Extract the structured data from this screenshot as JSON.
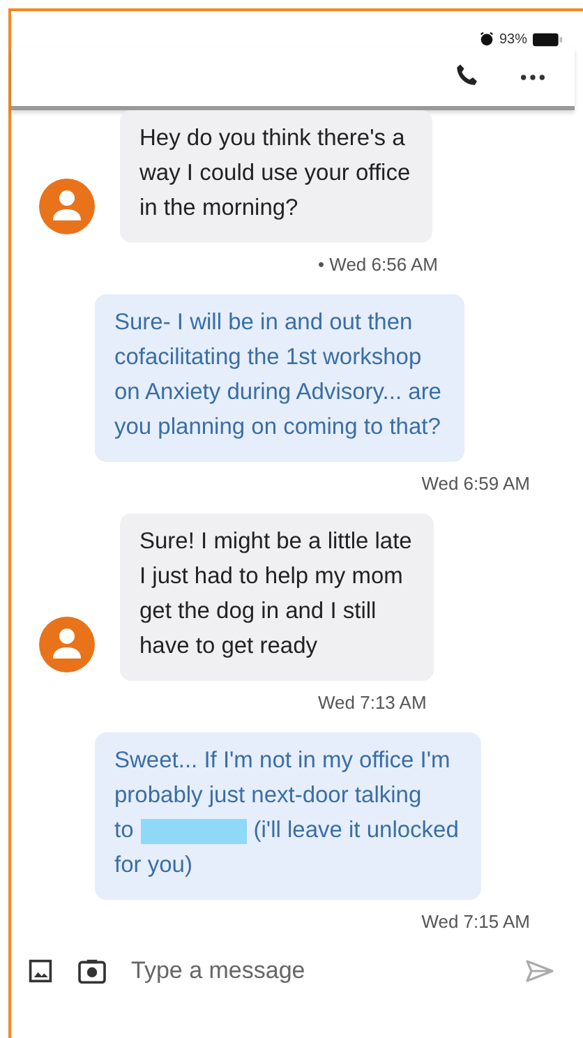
{
  "status_bar": {
    "battery": "93%"
  },
  "messages": [
    {
      "kind": "incoming",
      "parts": [
        {
          "kind": "text",
          "text": "Hey do you think there's a\nway I could use your office\nin the morning?"
        }
      ],
      "time": "• Wed 6:56 AM"
    },
    {
      "kind": "outgoing",
      "parts": [
        {
          "kind": "text",
          "text": "Sure- I will be in and out then\ncofacilitating the 1st workshop\non Anxiety during Advisory... are\nyou planning on coming to that?"
        }
      ],
      "time": "Wed 6:59 AM"
    },
    {
      "kind": "incoming",
      "parts": [
        {
          "kind": "text",
          "text": "Sure! I might be a little late\nI just had to help my mom\nget the dog in and I still\nhave to get ready"
        }
      ],
      "time": "Wed 7:13 AM"
    },
    {
      "kind": "outgoing",
      "parts": [
        {
          "kind": "text",
          "text": "Sweet... If I'm not in my office I'm\nprobably just next-door talking"
        },
        {
          "kind": "redacted_line",
          "before": "to",
          "after": "(i'll leave it unlocked"
        },
        {
          "kind": "text",
          "text": "for you)"
        }
      ],
      "time": "Wed 7:15 AM"
    }
  ],
  "composer": {
    "placeholder": "Type a message"
  }
}
